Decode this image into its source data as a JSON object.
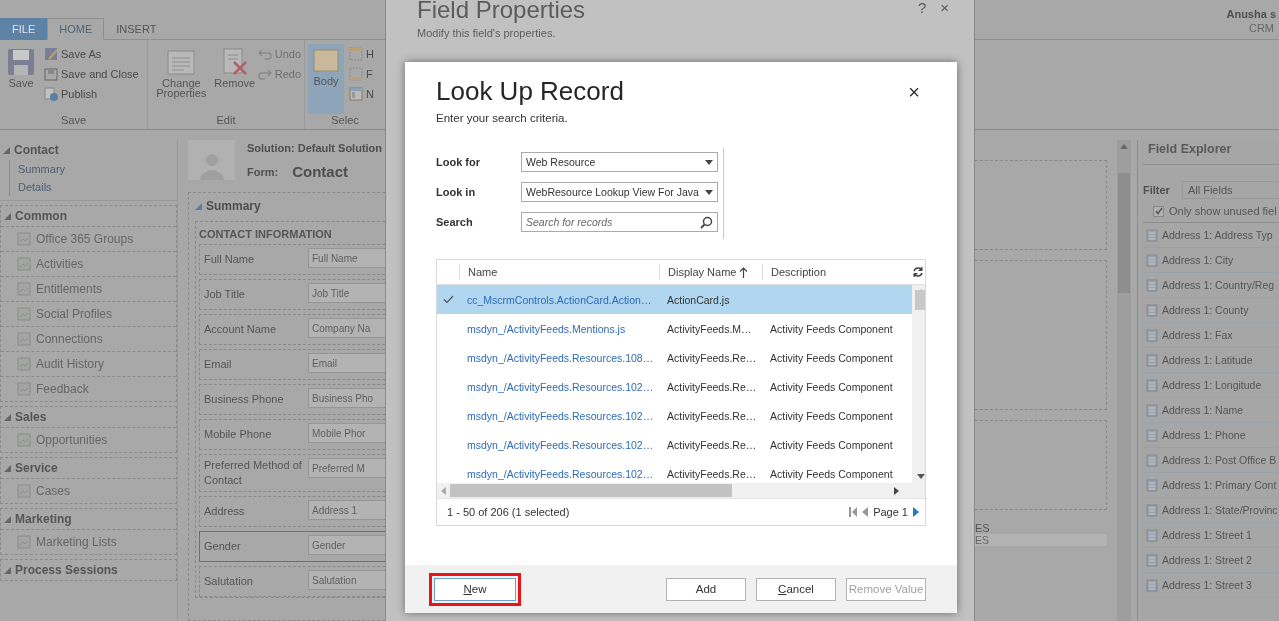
{
  "ribbon": {
    "tabs": [
      {
        "label": "FILE",
        "kind": "file",
        "selected": false
      },
      {
        "label": "HOME",
        "kind": "tab",
        "selected": true
      },
      {
        "label": "INSERT",
        "kind": "tab",
        "selected": false
      }
    ],
    "groups": [
      {
        "label": "Save",
        "large": [
          {
            "label": "Save",
            "kind": "floppy",
            "selected": false
          }
        ],
        "small": [
          {
            "label": "Save As",
            "kind": "save-as",
            "disabled": false
          },
          {
            "label": "Save and Close",
            "kind": "save-close",
            "disabled": false
          },
          {
            "label": "Publish",
            "kind": "publish",
            "disabled": false
          }
        ]
      },
      {
        "label": "Edit",
        "large": [
          {
            "label": "Change Properties",
            "kind": "properties",
            "selected": false
          },
          {
            "label": "Remove",
            "kind": "remove",
            "selected": false
          }
        ],
        "small": [
          {
            "label": "Undo",
            "kind": "undo",
            "disabled": true
          },
          {
            "label": "Redo",
            "kind": "redo",
            "disabled": true
          }
        ]
      },
      {
        "label": "Selec",
        "large": [
          {
            "label": "Body",
            "kind": "body",
            "selected": true
          }
        ],
        "small": [
          {
            "label": "H",
            "kind": "header",
            "disabled": false
          },
          {
            "label": "F",
            "kind": "footer",
            "disabled": false
          },
          {
            "label": "N",
            "kind": "nav",
            "disabled": false
          }
        ]
      }
    ]
  },
  "user": {
    "name": "Anusha s",
    "org": "CRM"
  },
  "nav": [
    {
      "title": "Contact",
      "kind": "tree",
      "items": [
        "Summary",
        "Details"
      ]
    },
    {
      "title": "Common",
      "kind": "list",
      "items": [
        "Office 365 Groups",
        "Activities",
        "Entitlements",
        "Social Profiles",
        "Connections",
        "Audit History",
        "Feedback"
      ]
    },
    {
      "title": "Sales",
      "kind": "list",
      "items": [
        "Opportunities"
      ]
    },
    {
      "title": "Service",
      "kind": "list",
      "items": [
        "Cases"
      ]
    },
    {
      "title": "Marketing",
      "kind": "list",
      "items": [
        "Marketing Lists"
      ]
    },
    {
      "title": "Process Sessions",
      "kind": "list"
    }
  ],
  "form": {
    "solution": "Solution: Default Solution",
    "form_label": "Form:",
    "form_name": "Contact",
    "tab_title": "Summary",
    "section_title": "CONTACT INFORMATION",
    "fields": [
      {
        "label": "Full Name",
        "placeholder": "Full Name",
        "selected": false
      },
      {
        "label": "Job Title",
        "placeholder": "Job Title",
        "selected": false
      },
      {
        "label": "Account Name",
        "placeholder": "Company Na",
        "selected": false
      },
      {
        "label": "Email",
        "placeholder": "Email",
        "selected": false
      },
      {
        "label": "Business Phone",
        "placeholder": "Business Pho",
        "selected": false
      },
      {
        "label": "Mobile Phone",
        "placeholder": "Mobile Phor",
        "selected": false
      },
      {
        "label": "Preferred Method of Contact",
        "placeholder": "Preferred M",
        "selected": false
      },
      {
        "label": "Address",
        "placeholder": "Address 1",
        "selected": false
      },
      {
        "label": "Gender",
        "placeholder": "Gender",
        "selected": true
      },
      {
        "label": "Salutation",
        "placeholder": "Salutation",
        "selected": false
      }
    ],
    "fragment": {
      "heading": "ES",
      "placeholder": "ES"
    }
  },
  "field_properties": {
    "title": "Field Properties",
    "subtitle": "Modify this field's properties.",
    "help": "?",
    "close": "×"
  },
  "lookup": {
    "title": "Look Up Record",
    "subtitle": "Enter your search criteria.",
    "close": "×",
    "criteria": [
      {
        "label": "Look for",
        "kind": "select",
        "value": "Web Resource"
      },
      {
        "label": "Look in",
        "kind": "select",
        "value": "WebResource Lookup View For Java"
      },
      {
        "label": "Search",
        "kind": "search",
        "placeholder": "Search for records"
      }
    ],
    "grid": {
      "columns": [
        {
          "label": "Name",
          "sorted": false
        },
        {
          "label": "Display Name",
          "sorted": true
        },
        {
          "label": "Description",
          "sorted": false
        }
      ],
      "rows": [
        {
          "selected": true,
          "name": "cc_MscrmControls.ActionCard.Action…",
          "display_name": "ActionCard.js"
        },
        {
          "selected": false,
          "name": "msdyn_/ActivityFeeds.Mentions.js",
          "display_name": "ActivityFeeds.M…",
          "description": "Activity Feeds Component"
        },
        {
          "selected": false,
          "name": "msdyn_/ActivityFeeds.Resources.108…",
          "display_name": "ActivityFeeds.Re…",
          "description": "Activity Feeds Component"
        },
        {
          "selected": false,
          "name": "msdyn_/ActivityFeeds.Resources.102…",
          "display_name": "ActivityFeeds.Re…",
          "description": "Activity Feeds Component"
        },
        {
          "selected": false,
          "name": "msdyn_/ActivityFeeds.Resources.102…",
          "display_name": "ActivityFeeds.Re…",
          "description": "Activity Feeds Component"
        },
        {
          "selected": false,
          "name": "msdyn_/ActivityFeeds.Resources.102…",
          "display_name": "ActivityFeeds.Re…",
          "description": "Activity Feeds Component"
        },
        {
          "selected": false,
          "name": "msdyn_/ActivityFeeds.Resources.102…",
          "display_name": "ActivityFeeds.Re…",
          "description": "Activity Feeds Component"
        }
      ],
      "status": "1 - 50 of 206 (1 selected)",
      "page": "Page 1"
    },
    "buttons": [
      {
        "label": "New",
        "highlighted": true,
        "mnemonic": true,
        "disabled": false
      },
      {
        "label": "Add",
        "highlighted": false,
        "mnemonic": false,
        "disabled": false
      },
      {
        "label": "Cancel",
        "highlighted": false,
        "mnemonic": true,
        "disabled": false
      },
      {
        "label": "Remove Value",
        "highlighted": false,
        "mnemonic": false,
        "disabled": true
      }
    ]
  },
  "explorer": {
    "title": "Field Explorer",
    "filter_label": "Filter",
    "filter_value": "All Fields",
    "unused_label": "Only show unused fiel",
    "unused_checked": true,
    "items": [
      "Address 1: Address Typ",
      "Address 1: City",
      "Address 1: Country/Reg",
      "Address 1: County",
      "Address 1: Fax",
      "Address 1: Latitude",
      "Address 1: Longitude",
      "Address 1: Name",
      "Address 1: Phone",
      "Address 1: Post Office B",
      "Address 1: Primary Cont",
      "Address 1: State/Provinc",
      "Address 1: Street 1",
      "Address 1: Street 2",
      "Address 1: Street 3"
    ]
  }
}
